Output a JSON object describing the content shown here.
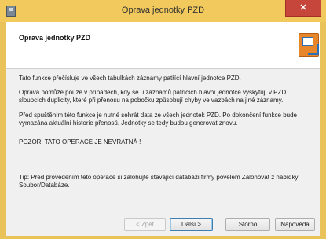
{
  "window": {
    "title": "Oprava jednotky PZD",
    "close_glyph": "✕",
    "app_icon": "window-app-icon"
  },
  "header": {
    "title": "Oprava jednotky PZD",
    "icon": "wizard-icon"
  },
  "content": {
    "p1": "Tato funkce přečísluje ve všech tabulkách záznamy patřící hlavní jednotce PZD.",
    "p2": "Oprava pomůže pouze v případech, kdy se u záznamů patřících hlavní jednotce vyskytují v PZD sloupcích duplicity, které při přenosu na pobočku způsobují chyby ve vazbách na jiné záznamy.",
    "p3": "Před spuštěním této funkce je nutné sehrát data ze všech jednotek PZD. Po dokončení funkce bude vymazána aktuální historie přenosů. Jednotky se tedy budou generovat znovu.",
    "warning": "POZOR, TATO OPERACE JE NEVRATNÁ !",
    "tip": "Tip: Před provedením této operace si zálohujte stávající databázi firmy povelem Zálohovat z nabídky Soubor/Databáze."
  },
  "buttons": {
    "back": "< Zpět",
    "next": "Další >",
    "cancel": "Storno",
    "help": "Nápověda"
  },
  "colors": {
    "title_bar": "#f1c95c",
    "close_button": "#c7463c",
    "client_bg": "#f0f0f0",
    "header_bg": "#ffffff"
  }
}
